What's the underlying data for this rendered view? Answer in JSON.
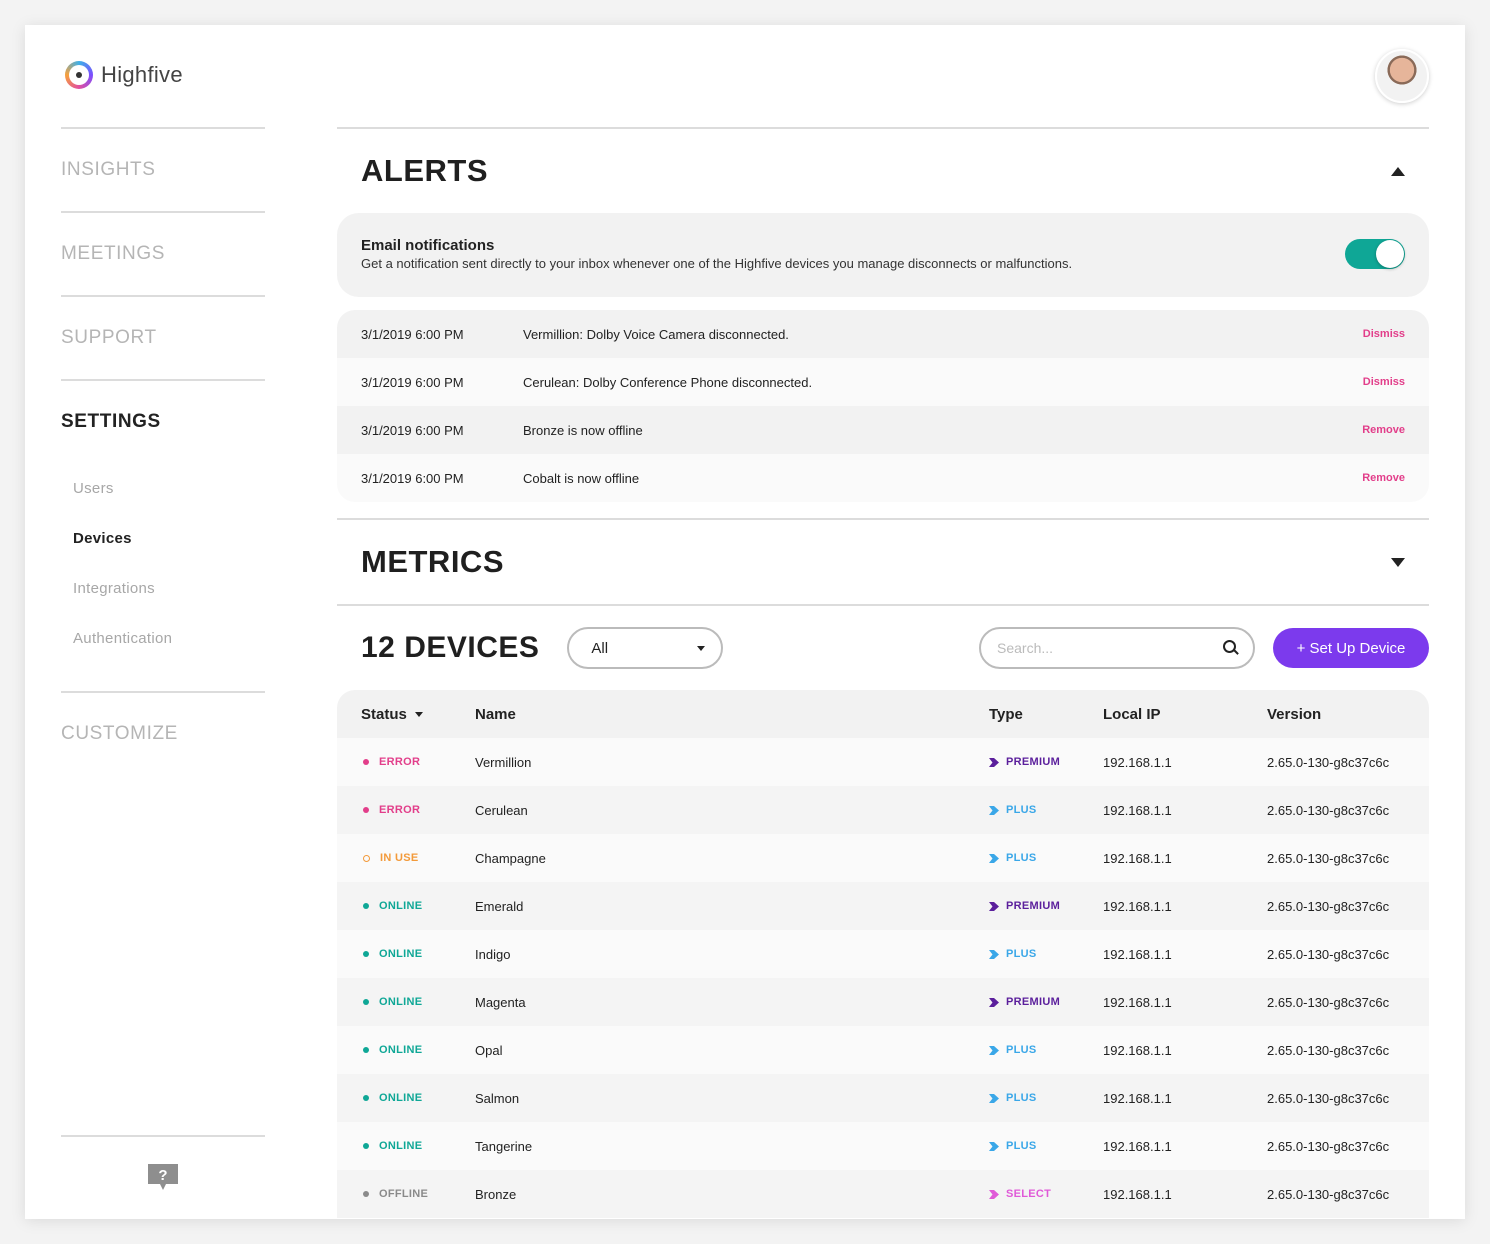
{
  "brand": {
    "name": "Highfive"
  },
  "nav": {
    "items": [
      "INSIGHTS",
      "MEETINGS",
      "SUPPORT",
      "SETTINGS",
      "CUSTOMIZE"
    ],
    "settings_sub": [
      "Users",
      "Devices",
      "Integrations",
      "Authentication"
    ]
  },
  "alerts": {
    "title": "ALERTS",
    "email_title": "Email notifications",
    "email_desc": "Get a notification sent directly to your inbox whenever one of the Highfive devices you manage disconnects or malfunctions.",
    "email_enabled": true,
    "rows": [
      {
        "time": "3/1/2019 6:00 PM",
        "message": "Vermillion: Dolby Voice Camera disconnected.",
        "action": "Dismiss"
      },
      {
        "time": "3/1/2019 6:00 PM",
        "message": "Cerulean: Dolby Conference Phone disconnected.",
        "action": "Dismiss"
      },
      {
        "time": "3/1/2019 6:00 PM",
        "message": "Bronze is now offline",
        "action": "Remove"
      },
      {
        "time": "3/1/2019 6:00 PM",
        "message": "Cobalt is now offline",
        "action": "Remove"
      }
    ]
  },
  "metrics": {
    "title": "METRICS"
  },
  "devices": {
    "title": "12 DEVICES",
    "filter_value": "All",
    "search_placeholder": "Search...",
    "setup_label": "+ Set Up Device",
    "columns": {
      "status": "Status",
      "name": "Name",
      "type": "Type",
      "ip": "Local IP",
      "version": "Version"
    },
    "rows": [
      {
        "status": "ERROR",
        "name": "Vermillion",
        "type": "PREMIUM",
        "ip": "192.168.1.1",
        "version": "2.65.0-130-g8c37c6c"
      },
      {
        "status": "ERROR",
        "name": "Cerulean",
        "type": "PLUS",
        "ip": "192.168.1.1",
        "version": "2.65.0-130-g8c37c6c"
      },
      {
        "status": "IN USE",
        "name": "Champagne",
        "type": "PLUS",
        "ip": "192.168.1.1",
        "version": "2.65.0-130-g8c37c6c"
      },
      {
        "status": "ONLINE",
        "name": "Emerald",
        "type": "PREMIUM",
        "ip": "192.168.1.1",
        "version": "2.65.0-130-g8c37c6c"
      },
      {
        "status": "ONLINE",
        "name": "Indigo",
        "type": "PLUS",
        "ip": "192.168.1.1",
        "version": "2.65.0-130-g8c37c6c"
      },
      {
        "status": "ONLINE",
        "name": "Magenta",
        "type": "PREMIUM",
        "ip": "192.168.1.1",
        "version": "2.65.0-130-g8c37c6c"
      },
      {
        "status": "ONLINE",
        "name": "Opal",
        "type": "PLUS",
        "ip": "192.168.1.1",
        "version": "2.65.0-130-g8c37c6c"
      },
      {
        "status": "ONLINE",
        "name": "Salmon",
        "type": "PLUS",
        "ip": "192.168.1.1",
        "version": "2.65.0-130-g8c37c6c"
      },
      {
        "status": "ONLINE",
        "name": "Tangerine",
        "type": "PLUS",
        "ip": "192.168.1.1",
        "version": "2.65.0-130-g8c37c6c"
      },
      {
        "status": "OFFLINE",
        "name": "Bronze",
        "type": "SELECT",
        "ip": "192.168.1.1",
        "version": "2.65.0-130-g8c37c6c"
      }
    ]
  },
  "colors": {
    "accent": "#7c3aed",
    "toggle_on": "#0fa796",
    "status": {
      "ERROR": "#e23e8a",
      "IN USE": "#f39a3a",
      "ONLINE": "#0fa796",
      "OFFLINE": "#8a8a8a"
    },
    "type": {
      "PREMIUM": "#5b1f9c",
      "PLUS": "#3aa7e8",
      "SELECT": "#e05ad8"
    }
  },
  "icons": {
    "logo": "highfive-logo-icon",
    "help": "help-question-icon",
    "search": "search-icon",
    "avatar": "user-avatar"
  }
}
